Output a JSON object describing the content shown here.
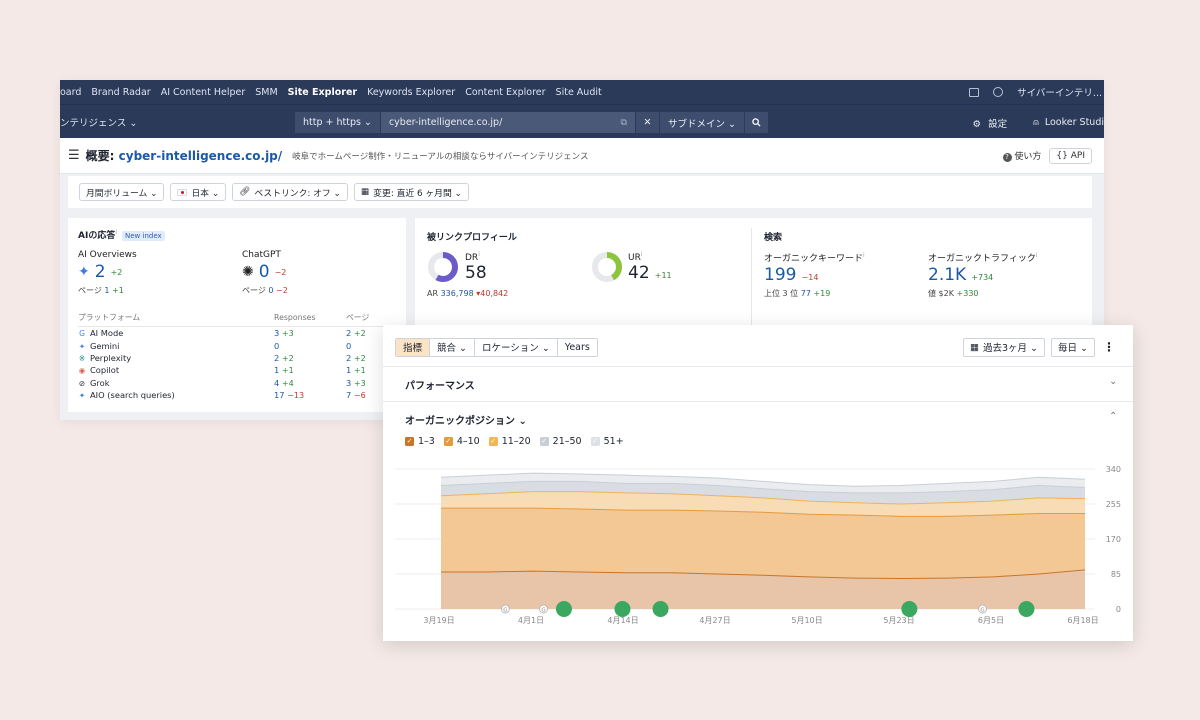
{
  "topnav": {
    "items": [
      "oard",
      "Brand Radar",
      "AI Content Helper",
      "SMM",
      "Site Explorer",
      "Keywords Explorer",
      "Content Explorer",
      "Site Audit"
    ],
    "account": "サイバーインテリ..."
  },
  "subnav": {
    "project": "ンテリジェンス ⌄",
    "protocol": "http + https ⌄",
    "url": "cyber-intelligence.co.jp/",
    "mode": "サブドメイン ⌄",
    "settings": "設定",
    "looker": "Looker Studi"
  },
  "header": {
    "title_prefix": "概要: ",
    "title_domain": "cyber-intelligence.co.jp/",
    "description": "岐阜でホームページ制作・リニューアルの相談ならサイバーインテリジェンス",
    "help": "使い方",
    "api": "API"
  },
  "filters": {
    "volume": "月間ボリューム ⌄",
    "country": "日本 ⌄",
    "bestlinks": "ベストリンク: オフ ⌄",
    "change": "変更: 直近 6 ヶ月間 ⌄"
  },
  "ai_card": {
    "title": "AIの応答",
    "title_info": "i",
    "badge": "New index",
    "overviews": {
      "label": "AI Overviews",
      "value": "2",
      "delta": "+2",
      "pages_label": "ページ",
      "pages": "1",
      "pages_delta": "+1"
    },
    "chatgpt": {
      "label": "ChatGPT",
      "value": "0",
      "delta": "−2",
      "pages_label": "ページ",
      "pages": "0",
      "pages_delta": "−2"
    },
    "table": {
      "headers": [
        "プラットフォーム",
        "Responses",
        "ページ"
      ],
      "rows": [
        {
          "icon": "G",
          "icon_name": "google-icon",
          "name": "AI Mode",
          "r": "3",
          "rd": "+3",
          "p": "2",
          "pd": "+2"
        },
        {
          "icon": "✦",
          "icon_name": "gemini-icon",
          "name": "Gemini",
          "r": "0",
          "rd": "",
          "p": "0",
          "pd": ""
        },
        {
          "icon": "※",
          "icon_name": "perplexity-icon",
          "name": "Perplexity",
          "r": "2",
          "rd": "+2",
          "p": "2",
          "pd": "+2"
        },
        {
          "icon": "◉",
          "icon_name": "copilot-icon",
          "name": "Copilot",
          "r": "1",
          "rd": "+1",
          "p": "1",
          "pd": "+1"
        },
        {
          "icon": "⊘",
          "icon_name": "grok-icon",
          "name": "Grok",
          "r": "4",
          "rd": "+4",
          "p": "3",
          "pd": "+3"
        },
        {
          "icon": "✦",
          "icon_name": "aio-icon",
          "name": "AIO (search queries)",
          "r": "17",
          "rd": "−13",
          "p": "7",
          "pd": "−6"
        }
      ]
    }
  },
  "backlinks": {
    "title": "被リンクプロフィール",
    "dr": {
      "label": "DR",
      "info": "i",
      "value": "58",
      "fraction": 0.58
    },
    "ar": {
      "label": "AR",
      "value": "336,798",
      "delta": "▾40,842"
    },
    "ur": {
      "label": "UR",
      "info": "i",
      "value": "42",
      "delta": "+11",
      "fraction": 0.42
    }
  },
  "search": {
    "title": "検索",
    "keywords": {
      "label": "オーガニックキーワード",
      "info": "i",
      "value": "199",
      "delta": "−14",
      "top3_label": "上位 3 位",
      "top3": "77",
      "top3_delta": "+19"
    },
    "traffic": {
      "label": "オーガニックトラフィック",
      "info": "i",
      "value": "2.1K",
      "delta": "+734",
      "value_label": "値",
      "val": "$2K",
      "val_delta": "+330"
    }
  },
  "panel": {
    "tabs": [
      "指標",
      "競合 ⌄",
      "ロケーション ⌄",
      "Years"
    ],
    "period": "過去3ヶ月 ⌄",
    "interval": "毎日 ⌄",
    "performance": "パフォーマンス",
    "positions": "オーガニックポジション ⌄",
    "legend": [
      {
        "label": "1–3",
        "color": "#c8752a"
      },
      {
        "label": "4–10",
        "color": "#e69a3c"
      },
      {
        "label": "11–20",
        "color": "#f2b65a"
      },
      {
        "label": "21–50",
        "color": "#c9ced6"
      },
      {
        "label": "51+",
        "color": "#dde1e6"
      }
    ]
  },
  "chart_data": {
    "type": "area",
    "x": [
      "3月19日",
      "3月26日",
      "4月1日",
      "4月7日",
      "4月14日",
      "4月20日",
      "4月27日",
      "5月3日",
      "5月10日",
      "5月16日",
      "5月23日",
      "5月29日",
      "6月5日",
      "6月11日",
      "6月18日"
    ],
    "xticks": [
      "3月19日",
      "4月1日",
      "4月14日",
      "4月27日",
      "5月10日",
      "5月23日",
      "6月5日",
      "6月18日"
    ],
    "yticks": [
      "0",
      "85",
      "170",
      "255",
      "340"
    ],
    "ylim": [
      0,
      340
    ],
    "series": [
      {
        "name": "1–3",
        "color": "#e8c4a8",
        "values": [
          90,
          90,
          92,
          90,
          88,
          88,
          85,
          82,
          78,
          75,
          74,
          75,
          78,
          85,
          95
        ]
      },
      {
        "name": "4–10",
        "color": "#f3c894",
        "values": [
          245,
          245,
          245,
          243,
          240,
          240,
          238,
          235,
          230,
          228,
          225,
          225,
          228,
          232,
          232
        ]
      },
      {
        "name": "11–20",
        "color": "#f8dcb6",
        "values": [
          275,
          280,
          285,
          285,
          282,
          280,
          275,
          270,
          262,
          258,
          255,
          258,
          262,
          270,
          268
        ]
      },
      {
        "name": "21–50",
        "color": "#d9dde3",
        "values": [
          300,
          305,
          310,
          310,
          305,
          305,
          300,
          292,
          285,
          282,
          282,
          285,
          290,
          300,
          295
        ]
      },
      {
        "name": "51+",
        "color": "#eaecf0",
        "values": [
          320,
          325,
          330,
          328,
          325,
          322,
          318,
          310,
          302,
          298,
          300,
          305,
          310,
          320,
          315
        ]
      }
    ],
    "events": [
      {
        "kind": "google",
        "x": 2.2,
        "label": "G"
      },
      {
        "kind": "google",
        "x": 3.5,
        "label": "G"
      },
      {
        "kind": "dot",
        "x": 4.2
      },
      {
        "kind": "dot",
        "x": 6.2
      },
      {
        "kind": "dot",
        "x": 7.5
      },
      {
        "kind": "dot",
        "x": 16.0
      },
      {
        "kind": "google",
        "x": 18.5,
        "label": "G"
      },
      {
        "kind": "dot",
        "x": 20.0
      }
    ]
  }
}
